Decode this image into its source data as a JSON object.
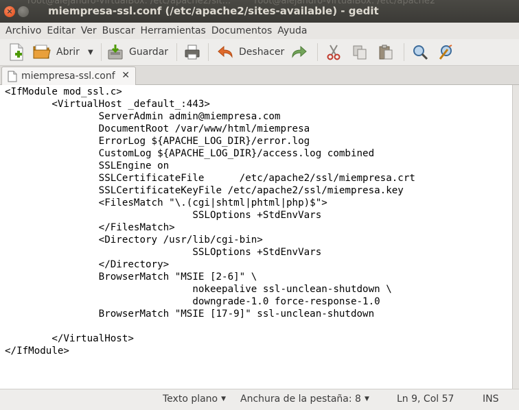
{
  "window": {
    "title": "miempresa-ssl.conf (/etc/apache2/sites-available) - gedit",
    "background_tabs": [
      "root@alejandro-VirtualBox: /etc/apache2/sit...",
      "root@alejandro-VirtualBox: /etc/apache2"
    ]
  },
  "menu": {
    "items": [
      "Archivo",
      "Editar",
      "Ver",
      "Buscar",
      "Herramientas",
      "Documentos",
      "Ayuda"
    ]
  },
  "toolbar": {
    "open_label": "Abrir",
    "save_label": "Guardar",
    "undo_label": "Deshacer"
  },
  "tab": {
    "label": "miempresa-ssl.conf",
    "close_glyph": "✕"
  },
  "editor": {
    "lines": [
      "<IfModule mod_ssl.c>",
      "        <VirtualHost _default_:443>",
      "                ServerAdmin admin@miempresa.com",
      "                DocumentRoot /var/www/html/miempresa",
      "                ErrorLog ${APACHE_LOG_DIR}/error.log",
      "                CustomLog ${APACHE_LOG_DIR}/access.log combined",
      "                SSLEngine on",
      "                SSLCertificateFile      /etc/apache2/ssl/miempresa.crt",
      "                SSLCertificateKeyFile /etc/apache2/ssl/miempresa.key",
      "                <FilesMatch \"\\.(cgi|shtml|phtml|php)$\">",
      "                                SSLOptions +StdEnvVars",
      "                </FilesMatch>",
      "                <Directory /usr/lib/cgi-bin>",
      "                                SSLOptions +StdEnvVars",
      "                </Directory>",
      "                BrowserMatch \"MSIE [2-6]\" \\",
      "                                nokeepalive ssl-unclean-shutdown \\",
      "                                downgrade-1.0 force-response-1.0",
      "                BrowserMatch \"MSIE [17-9]\" ssl-unclean-shutdown",
      "",
      "        </VirtualHost>",
      "</IfModule>"
    ]
  },
  "status": {
    "language": "Texto plano",
    "tab_width": "Anchura de la pestaña: 8",
    "position": "Ln 9, Col 57",
    "mode": "INS"
  },
  "icons": {
    "new": "new-document-icon",
    "open": "open-folder-icon",
    "save": "save-icon",
    "print": "print-icon",
    "undo": "undo-icon",
    "redo": "redo-icon",
    "cut": "cut-icon",
    "copy": "copy-icon",
    "paste": "paste-icon",
    "find": "find-icon",
    "replace": "find-replace-icon"
  },
  "colors": {
    "titlebar": "#3c3b37",
    "close_button": "#e9541e",
    "undo_arrow": "#e06a2c",
    "redo_arrow": "#6aa84f"
  }
}
